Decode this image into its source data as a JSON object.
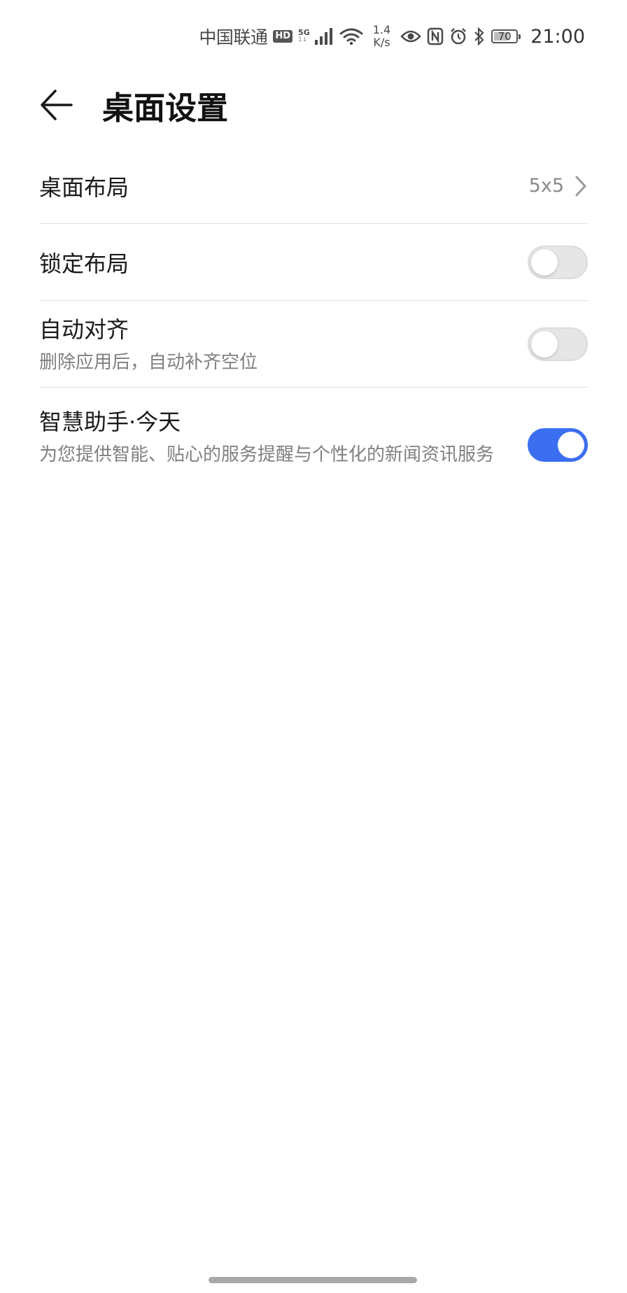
{
  "status_bar": {
    "carrier": "中国联通",
    "hd_badge": "HD",
    "network_type": "5G",
    "network_sub": "1↓",
    "speed_value": "1.4",
    "speed_unit": "K/s",
    "battery_level": "70",
    "battery_fraction": 0.7,
    "time": "21:00",
    "icons": [
      "signal-icon",
      "wifi-icon",
      "eye-icon",
      "nfc-icon",
      "alarm-icon",
      "bluetooth-icon",
      "battery-icon"
    ]
  },
  "header": {
    "title": "桌面设置",
    "back_icon": "back-arrow-icon"
  },
  "settings": {
    "layout": {
      "title": "桌面布局",
      "value": "5x5"
    },
    "lock_layout": {
      "title": "锁定布局",
      "enabled": false
    },
    "auto_align": {
      "title": "自动对齐",
      "subtitle": "删除应用后，自动补齐空位",
      "enabled": false
    },
    "smart_assistant": {
      "title": "智慧助手·今天",
      "subtitle": "为您提供智能、贴心的服务提醒与个性化的新闻资讯服务",
      "enabled": true
    }
  },
  "colors": {
    "accent": "#3c6ef0",
    "toggle_off": "#e6e6e6",
    "divider": "#dedede",
    "secondary_text": "#808080"
  }
}
